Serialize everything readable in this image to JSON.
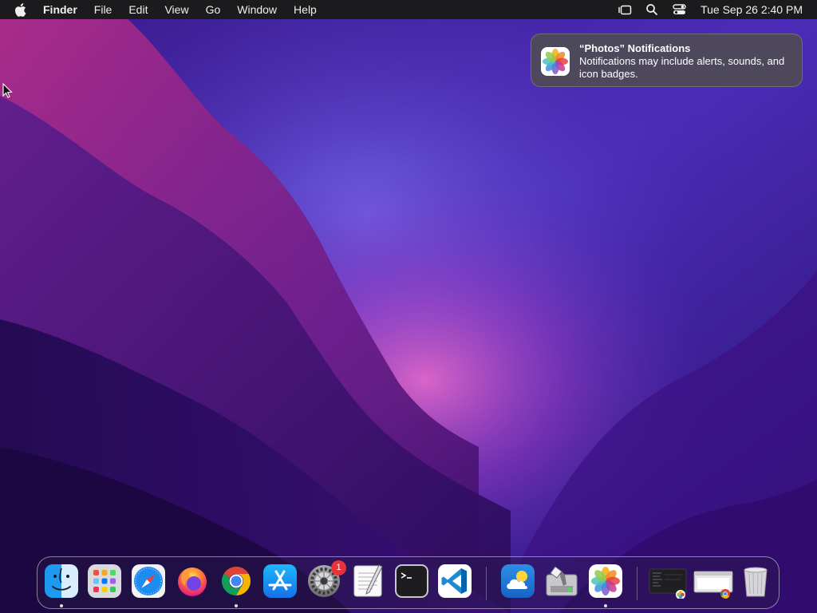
{
  "menubar": {
    "app_name": "Finder",
    "menus": [
      "File",
      "Edit",
      "View",
      "Go",
      "Window",
      "Help"
    ],
    "clock": "Tue Sep 26  2:40 PM",
    "status_icons": [
      "stage-manager-icon",
      "search-icon",
      "control-center-icon"
    ]
  },
  "notification": {
    "title": "“Photos” Notifications",
    "body": "Notifications may include alerts, sounds, and icon badges."
  },
  "dock": {
    "apps": [
      {
        "name": "finder-icon",
        "running": true
      },
      {
        "name": "launchpad-icon",
        "running": false
      },
      {
        "name": "safari-icon",
        "running": false
      },
      {
        "name": "firefox-icon",
        "running": false
      },
      {
        "name": "chrome-icon",
        "running": true
      },
      {
        "name": "app-store-icon",
        "running": false
      },
      {
        "name": "system-settings-icon",
        "running": false,
        "badge": "1"
      },
      {
        "name": "textedit-icon",
        "running": false
      },
      {
        "name": "terminal-icon",
        "running": false
      },
      {
        "name": "vscode-icon",
        "running": false
      },
      {
        "name": "weather-icon",
        "running": false
      },
      {
        "name": "disk-utility-icon",
        "running": false
      },
      {
        "name": "photos-icon",
        "running": true
      },
      {
        "name": "minimized-window-photos-icon",
        "running": false
      },
      {
        "name": "minimized-window-chrome-icon",
        "running": false
      },
      {
        "name": "trash-icon",
        "running": false
      }
    ]
  },
  "colors": {
    "menubar_bg": "#1b1b1d",
    "wallpaper_dark": "#240c5a",
    "wallpaper_accent": "#c0389e",
    "badge_red": "#e8333a"
  }
}
